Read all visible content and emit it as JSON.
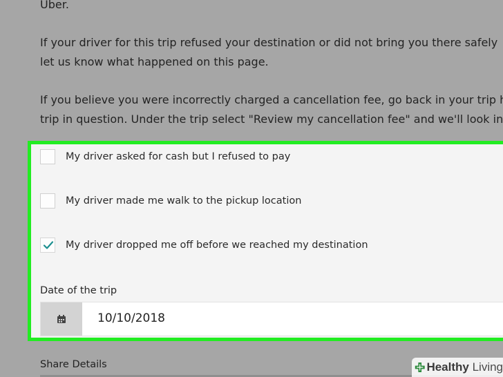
{
  "paragraphs": [
    "Uber.",
    "If your driver for this trip refused your destination or did not bring you there safely",
    "let us know what happened on this page.",
    "If you believe you were incorrectly charged a cancellation fee, go back in your trip h",
    "trip in question. Under the trip select \"Review my cancellation fee\" and we'll look into"
  ],
  "options": [
    {
      "label": "My driver asked for cash but I refused to pay",
      "checked": false
    },
    {
      "label": "My driver made me walk to the pickup location",
      "checked": false
    },
    {
      "label": "My driver dropped me off before we reached my destination",
      "checked": true
    }
  ],
  "date": {
    "label": "Date of the trip",
    "value": "10/10/2018",
    "icon": "calendar-icon"
  },
  "share": {
    "label": "Share Details"
  },
  "watermark": {
    "brand_bold": "Healthy",
    "brand_light": " Living",
    "icon": "plus-cross-icon"
  },
  "colors": {
    "highlight": "#22ec22",
    "check": "#1c8f8f"
  }
}
